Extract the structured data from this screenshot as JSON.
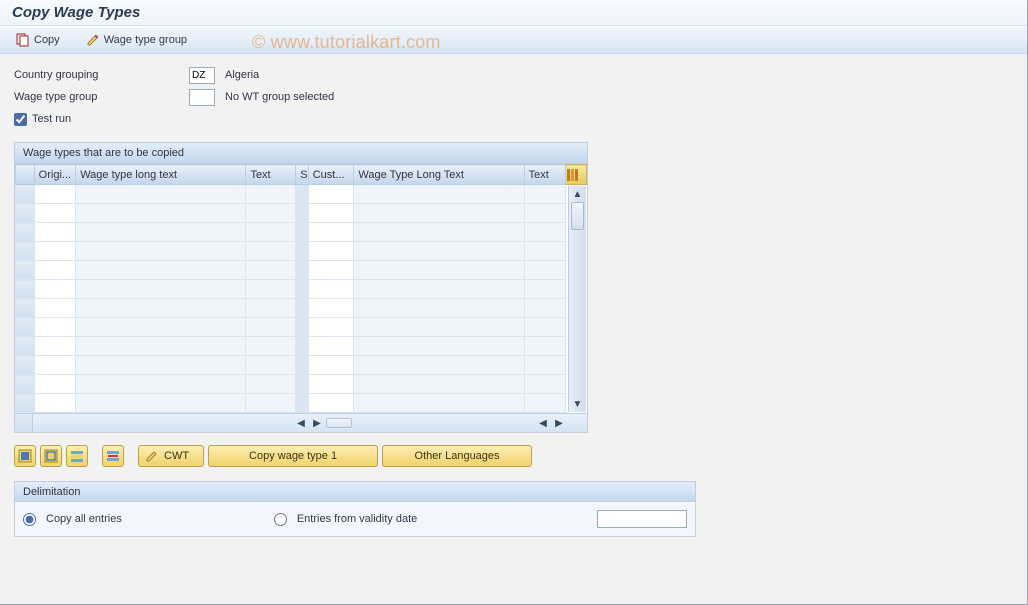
{
  "title": "Copy Wage Types",
  "watermark": "© www.tutorialkart.com",
  "toolbar": {
    "copy_label": "Copy",
    "wtg_label": "Wage type group"
  },
  "form": {
    "country_grouping_label": "Country grouping",
    "country_grouping_value": "DZ",
    "country_grouping_text": "Algeria",
    "wage_type_group_label": "Wage type group",
    "wage_type_group_value": "",
    "wage_type_group_text": "No WT group selected",
    "test_run_label": "Test run",
    "test_run_checked": true
  },
  "table": {
    "title": "Wage types that are to be copied",
    "columns": {
      "origi": "Origi...",
      "wtlt": "Wage type long text",
      "text": "Text",
      "s": "S",
      "cust": "Cust...",
      "wtlt2": "Wage Type Long Text",
      "text2": "Text"
    },
    "row_count": 12
  },
  "actions": {
    "cwt_label": "CWT",
    "copy_wt1_label": "Copy wage type 1",
    "other_lang_label": "Other Languages"
  },
  "delimitation": {
    "title": "Delimitation",
    "copy_all_label": "Copy all entries",
    "from_date_label": "Entries from validity date",
    "selected": "copy_all",
    "date_value": ""
  }
}
